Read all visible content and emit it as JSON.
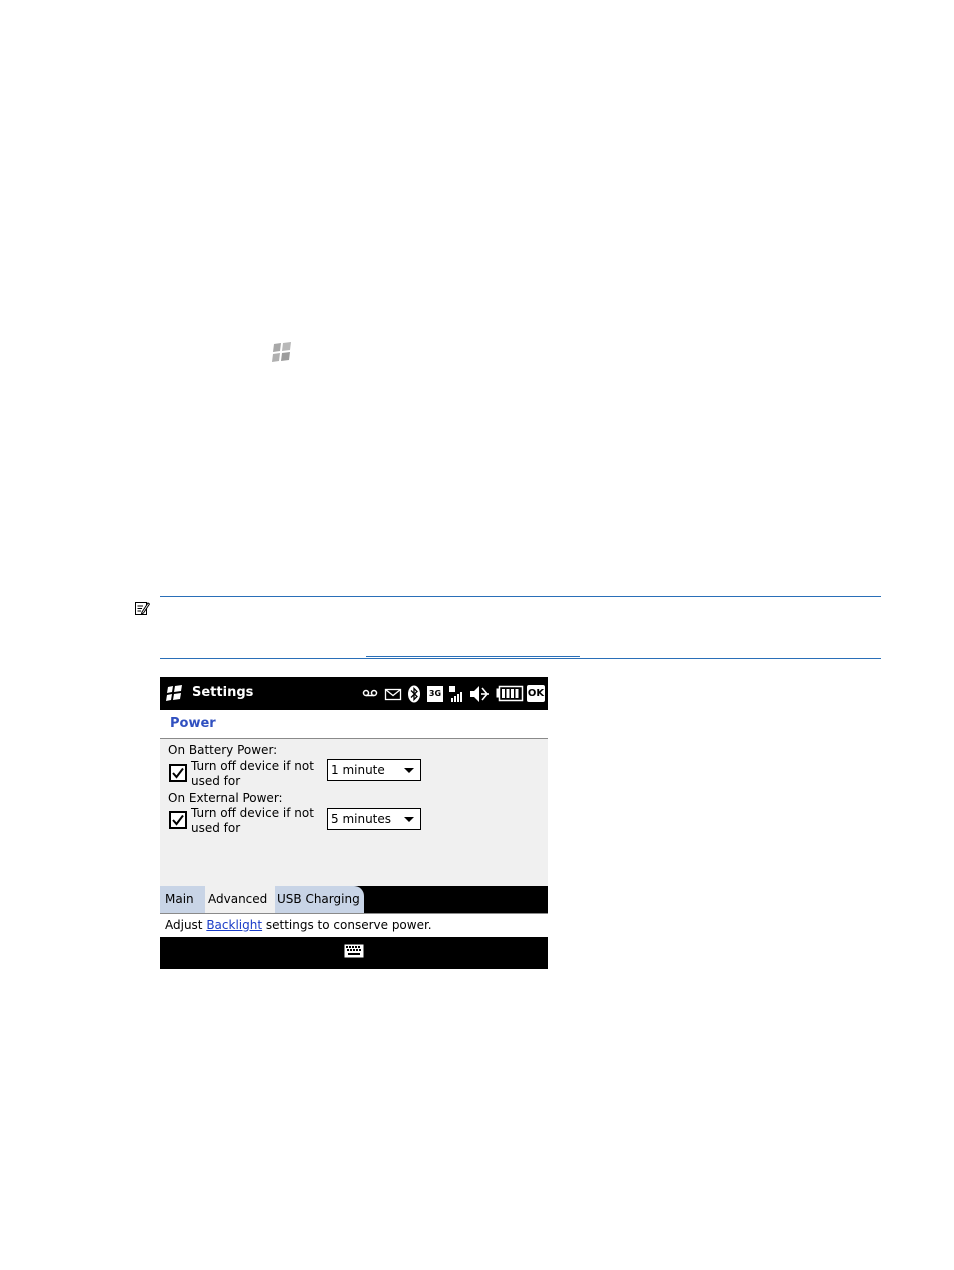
{
  "colors": {
    "accent_blue": "#3050c0",
    "link_blue": "#1a3cc8",
    "note_rule": "#2a6fb8",
    "tab_inactive": "#c8d4e6",
    "content_bg": "#f0f0f0"
  },
  "icons": {
    "page_logo": "windows-flag-icon",
    "note": "note-icon",
    "start": "windows-start-icon",
    "status": [
      "voicemail-icon",
      "email-icon",
      "bluetooth-icon",
      "3g-icon",
      "signal-icon",
      "volume-muted-icon",
      "battery-icon"
    ],
    "softkey": "keyboard-icon"
  },
  "device": {
    "title": "Settings",
    "ok_label": "OK",
    "page_title": "Power",
    "battery": {
      "section_label": "On Battery Power:",
      "checkbox_line1": "Turn off device if not",
      "checkbox_line2": "used for",
      "checked": true,
      "selected_value": "1 minute"
    },
    "external": {
      "section_label": "On External Power:",
      "checkbox_line1": "Turn off device if not",
      "checkbox_line2": "used for",
      "checked": true,
      "selected_value": "5 minutes"
    },
    "tabs": {
      "main": "Main",
      "advanced": "Advanced",
      "usb_charging": "USB Charging"
    },
    "status_text": {
      "before": "Adjust ",
      "link": "Backlight",
      "after": " settings to conserve power."
    },
    "status_icons": {
      "network": "3G"
    }
  }
}
